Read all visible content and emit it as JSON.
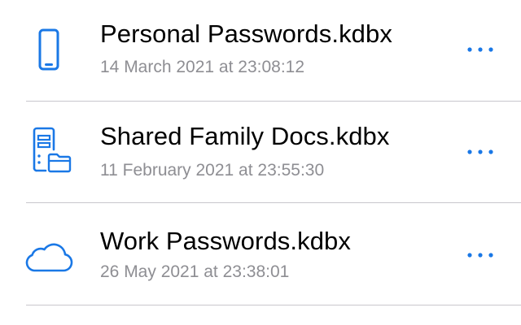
{
  "colors": {
    "accent": "#1a78e6",
    "title": "#000000",
    "subtitle": "#8e8e93",
    "divider": "#c8c7cc"
  },
  "files": [
    {
      "icon": "phone-icon",
      "name": "Personal Passwords.kdbx",
      "modified": "14 March 2021 at 23:08:12"
    },
    {
      "icon": "file-server-icon",
      "name": "Shared Family Docs.kdbx",
      "modified": "11 February 2021 at 23:55:30"
    },
    {
      "icon": "cloud-icon",
      "name": "Work Passwords.kdbx",
      "modified": "26 May 2021 at 23:38:01"
    }
  ],
  "more_icon": "ellipsis-icon"
}
